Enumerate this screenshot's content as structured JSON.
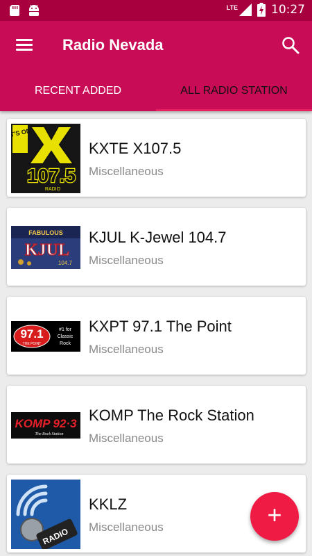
{
  "status_bar": {
    "time": "10:27",
    "network": "LTE"
  },
  "app_bar": {
    "title": "Radio Nevada"
  },
  "tabs": [
    {
      "label": "RECENT ADDED",
      "active": false
    },
    {
      "label": "ALL RADIO STATION",
      "active": true
    }
  ],
  "stations": [
    {
      "name": "KXTE X107.5",
      "category": "Miscellaneous",
      "logo": {
        "line1": "IT'S ON",
        "big": "X",
        "freq": "107.5",
        "tag": "RADIO"
      }
    },
    {
      "name": "KJUL K-Jewel 104.7",
      "category": "Miscellaneous",
      "logo": {
        "text": "KJUL",
        "top": "FABULOUS",
        "bottom": "104.7"
      }
    },
    {
      "name": "KXPT 97.1 The Point",
      "category": "Miscellaneous",
      "logo": {
        "freq": "97.1",
        "sub": "THE POINT",
        "side1": "#1 for",
        "side2": "Classic",
        "side3": "Rock"
      }
    },
    {
      "name": "KOMP The Rock Station",
      "category": "Miscellaneous",
      "logo": {
        "text": "KOMP 92·3",
        "sub": "The Rock Station"
      }
    },
    {
      "name": "KKLZ",
      "category": "Miscellaneous",
      "logo": {
        "text": "RADIO"
      }
    }
  ],
  "fab": {
    "label": "+"
  },
  "colors": {
    "primary": "#c90c56",
    "status_bar": "#a8003f",
    "accent": "#ef1b45"
  }
}
